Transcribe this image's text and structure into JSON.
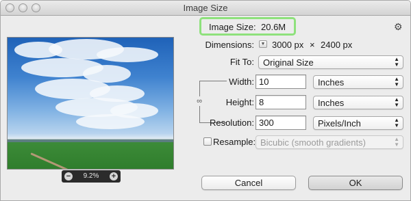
{
  "window": {
    "title": "Image Size"
  },
  "info": {
    "image_size_label": "Image Size:",
    "image_size_value": "20.6M"
  },
  "dimensions": {
    "label": "Dimensions:",
    "width": "3000 px",
    "times": "×",
    "height": "2400 px"
  },
  "fit_to": {
    "label": "Fit To:",
    "value": "Original Size"
  },
  "width": {
    "label": "Width:",
    "value": "10",
    "unit": "Inches"
  },
  "height": {
    "label": "Height:",
    "value": "8",
    "unit": "Inches"
  },
  "resolution": {
    "label": "Resolution:",
    "value": "300",
    "unit": "Pixels/Inch"
  },
  "resample": {
    "label": "Resample:",
    "checked": false,
    "method": "Bicubic (smooth gradients)"
  },
  "preview": {
    "zoom": "9.2%",
    "zoom_out": "−",
    "zoom_in": "+"
  },
  "buttons": {
    "cancel": "Cancel",
    "ok": "OK"
  },
  "colors": {
    "highlight": "#8ee17c"
  },
  "icons": {
    "settings": "gear-icon",
    "constrain": "link-icon"
  }
}
